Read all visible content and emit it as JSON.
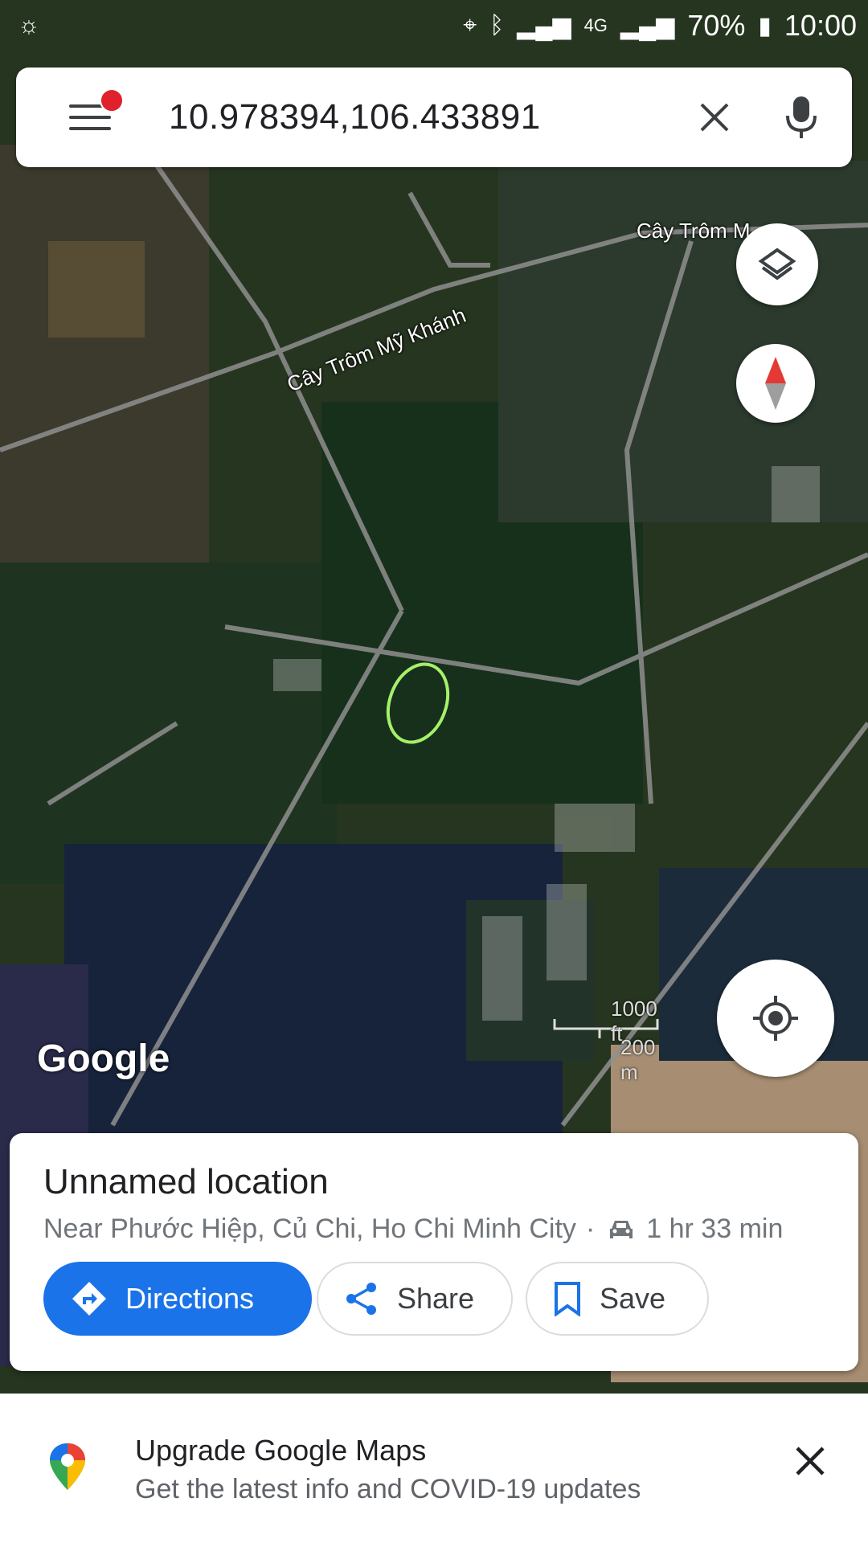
{
  "status_bar": {
    "battery": "70%",
    "time": "10:00",
    "network": "4G"
  },
  "search": {
    "query": "10.978394,106.433891"
  },
  "map": {
    "road_label_1": "Cây Trôm Mỹ Khánh",
    "road_label_2": "Cây Trôm M",
    "logo": "Google",
    "scale_imperial": "1000 ft",
    "scale_metric": "200 m"
  },
  "place_card": {
    "title": "Unnamed location",
    "address": "Near Phước Hiệp, Củ Chi, Ho Chi Minh City",
    "separator": "·",
    "drive_time": "1 hr 33 min",
    "directions_label": "Directions",
    "share_label": "Share",
    "save_label": "Save"
  },
  "banner": {
    "title": "Upgrade Google Maps",
    "subtitle": "Get the latest info and COVID-19 updates"
  },
  "colors": {
    "accent": "#1a73e8",
    "notification_dot": "#e0202a",
    "compass_red": "#e53935"
  },
  "icons": [
    "menu-icon",
    "close-icon",
    "mic-icon",
    "layers-icon",
    "compass-icon",
    "my-location-icon",
    "car-icon",
    "directions-icon",
    "share-icon",
    "bookmark-icon",
    "maps-pin-icon"
  ]
}
